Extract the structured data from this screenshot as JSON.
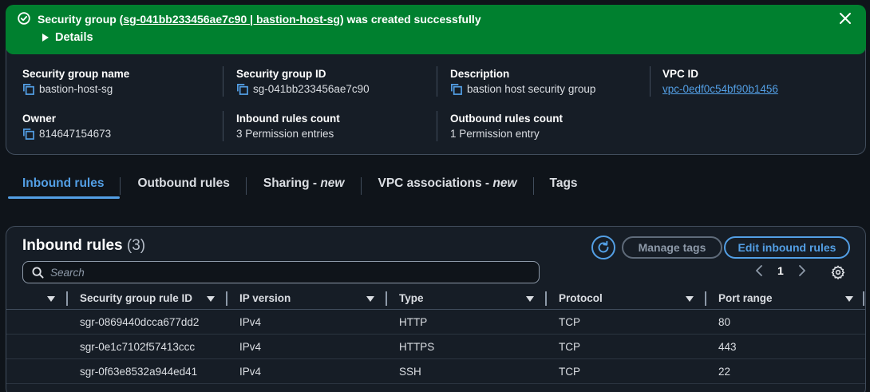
{
  "flash": {
    "message_prefix": "Security group (",
    "message_link": "sg-041bb233456ae7c90 | bastion-host-sg",
    "message_suffix": ") was created successfully",
    "details_label": "Details",
    "status_color": "#00802f"
  },
  "details": {
    "sg_name_label": "Security group name",
    "sg_name_value": "bastion-host-sg",
    "sg_id_label": "Security group ID",
    "sg_id_value": "sg-041bb233456ae7c90",
    "description_label": "Description",
    "description_value": "bastion host security group",
    "vpc_label": "VPC ID",
    "vpc_value": "vpc-0edf0c54bf90b1456",
    "owner_label": "Owner",
    "owner_value": "814647154673",
    "inbound_count_label": "Inbound rules count",
    "inbound_count_value": "3 Permission entries",
    "outbound_count_label": "Outbound rules count",
    "outbound_count_value": "1 Permission entry"
  },
  "tabs": [
    {
      "label": "Inbound rules",
      "suffix": "",
      "active": true
    },
    {
      "label": "Outbound rules",
      "suffix": "",
      "active": false
    },
    {
      "label": "Sharing - ",
      "suffix": "new",
      "active": false
    },
    {
      "label": "VPC associations - ",
      "suffix": "new",
      "active": false
    },
    {
      "label": "Tags",
      "suffix": "",
      "active": false
    }
  ],
  "rules": {
    "title": "Inbound rules",
    "count": "(3)",
    "manage_tags_label": "Manage tags",
    "edit_label": "Edit inbound rules",
    "search_placeholder": "Search",
    "current_page": "1",
    "columns": [
      "Security group rule ID",
      "IP version",
      "Type",
      "Protocol",
      "Port range"
    ],
    "rows": [
      {
        "id": "sgr-0869440dcca677dd2",
        "ip": "IPv4",
        "type": "HTTP",
        "protocol": "TCP",
        "port": "80"
      },
      {
        "id": "sgr-0e1c7102f57413ccc",
        "ip": "IPv4",
        "type": "HTTPS",
        "protocol": "TCP",
        "port": "443"
      },
      {
        "id": "sgr-0f63e8532a944ed41",
        "ip": "IPv4",
        "type": "SSH",
        "protocol": "TCP",
        "port": "22"
      }
    ]
  },
  "colors": {
    "accent": "#539fe5",
    "background": "#0f141a",
    "panel": "#161d26"
  },
  "icons": {
    "flash": "check-circle-icon",
    "close": "close-icon",
    "copy": "copy-icon",
    "refresh": "refresh-icon",
    "search": "search-icon",
    "settings": "gear-icon"
  }
}
